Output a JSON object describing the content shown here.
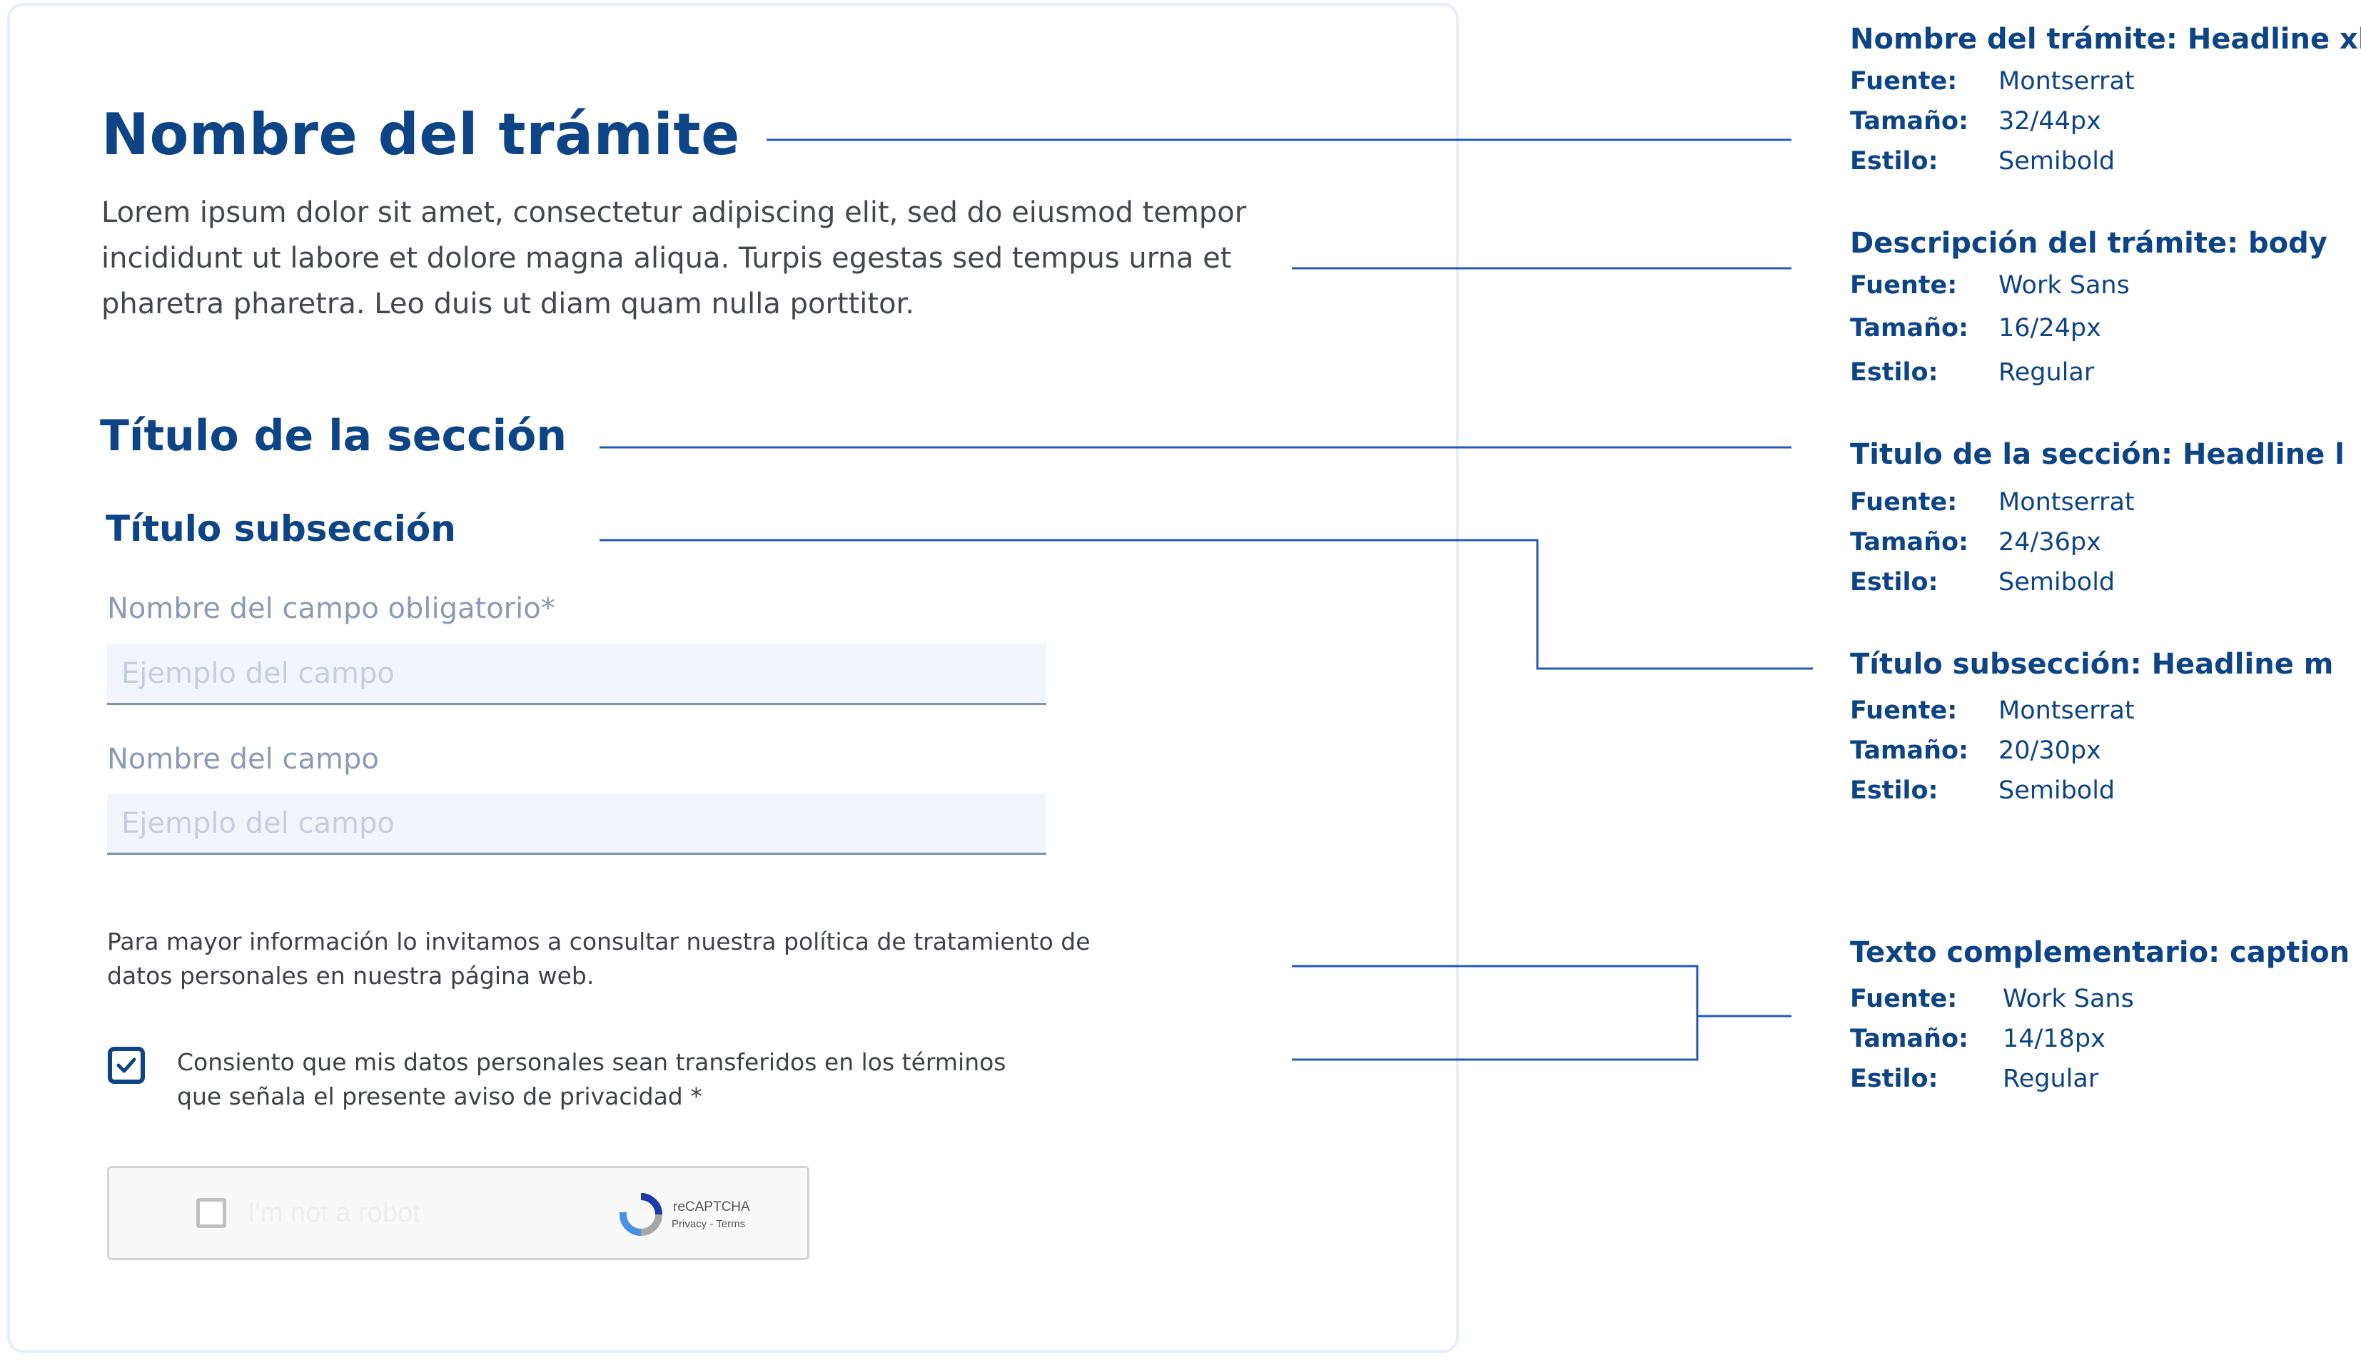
{
  "form": {
    "title": "Nombre del trámite",
    "description": "Lorem ipsum dolor sit amet, consectetur adipiscing elit, sed do eiusmod tempor incididunt ut labore et dolore magna aliqua. Turpis egestas sed tempus urna et pharetra pharetra. Leo duis ut diam quam nulla porttitor.",
    "section_title": "Título de la sección",
    "subsection_title": "Título subsección",
    "field_required": {
      "label": "Nombre del campo obligatorio*",
      "placeholder": "Ejemplo del campo",
      "value": ""
    },
    "field_optional": {
      "label": "Nombre del campo",
      "placeholder": "Ejemplo del campo",
      "value": ""
    },
    "privacy_note": "Para mayor información lo invitamos a consultar nuestra política de tratamiento de datos personales en nuestra página web.",
    "consent": {
      "label": "Consiento que mis datos personales sean transferidos en los términos que señala el presente aviso de privacidad *",
      "checked": true
    },
    "captcha": {
      "label": "I'm not a robot",
      "brand": "reCAPTCHA",
      "links": "Privacy - Terms",
      "checked": false
    }
  },
  "specs": {
    "keys": {
      "font": "Fuente:",
      "size": "Tamaño:",
      "style": "Estilo:"
    },
    "items": [
      {
        "title": "Nombre del trámite: Headline xl",
        "font": "Montserrat",
        "size": "32/44px",
        "style": "Semibold"
      },
      {
        "title": "Descripción del trámite: body",
        "font": "Work Sans",
        "size": "16/24px",
        "style": "Regular"
      },
      {
        "title": "Titulo de la sección: Headline l",
        "font": "Montserrat",
        "size": "24/36px",
        "style": "Semibold"
      },
      {
        "title": "Título subsección: Headline m",
        "font": "Montserrat",
        "size": "20/30px",
        "style": "Semibold"
      },
      {
        "title": "Texto complementario: caption",
        "font": "Work Sans",
        "size": "14/18px",
        "style": "Regular"
      }
    ]
  },
  "colors": {
    "primary": "#0d4486",
    "connector": "#2359b8",
    "label": "#8a9ab8",
    "input_bg": "#f1f5fd",
    "body_text": "#45474f"
  },
  "icons": {
    "checkbox": "checkmark-icon",
    "captcha": "recaptcha-logo-icon"
  }
}
